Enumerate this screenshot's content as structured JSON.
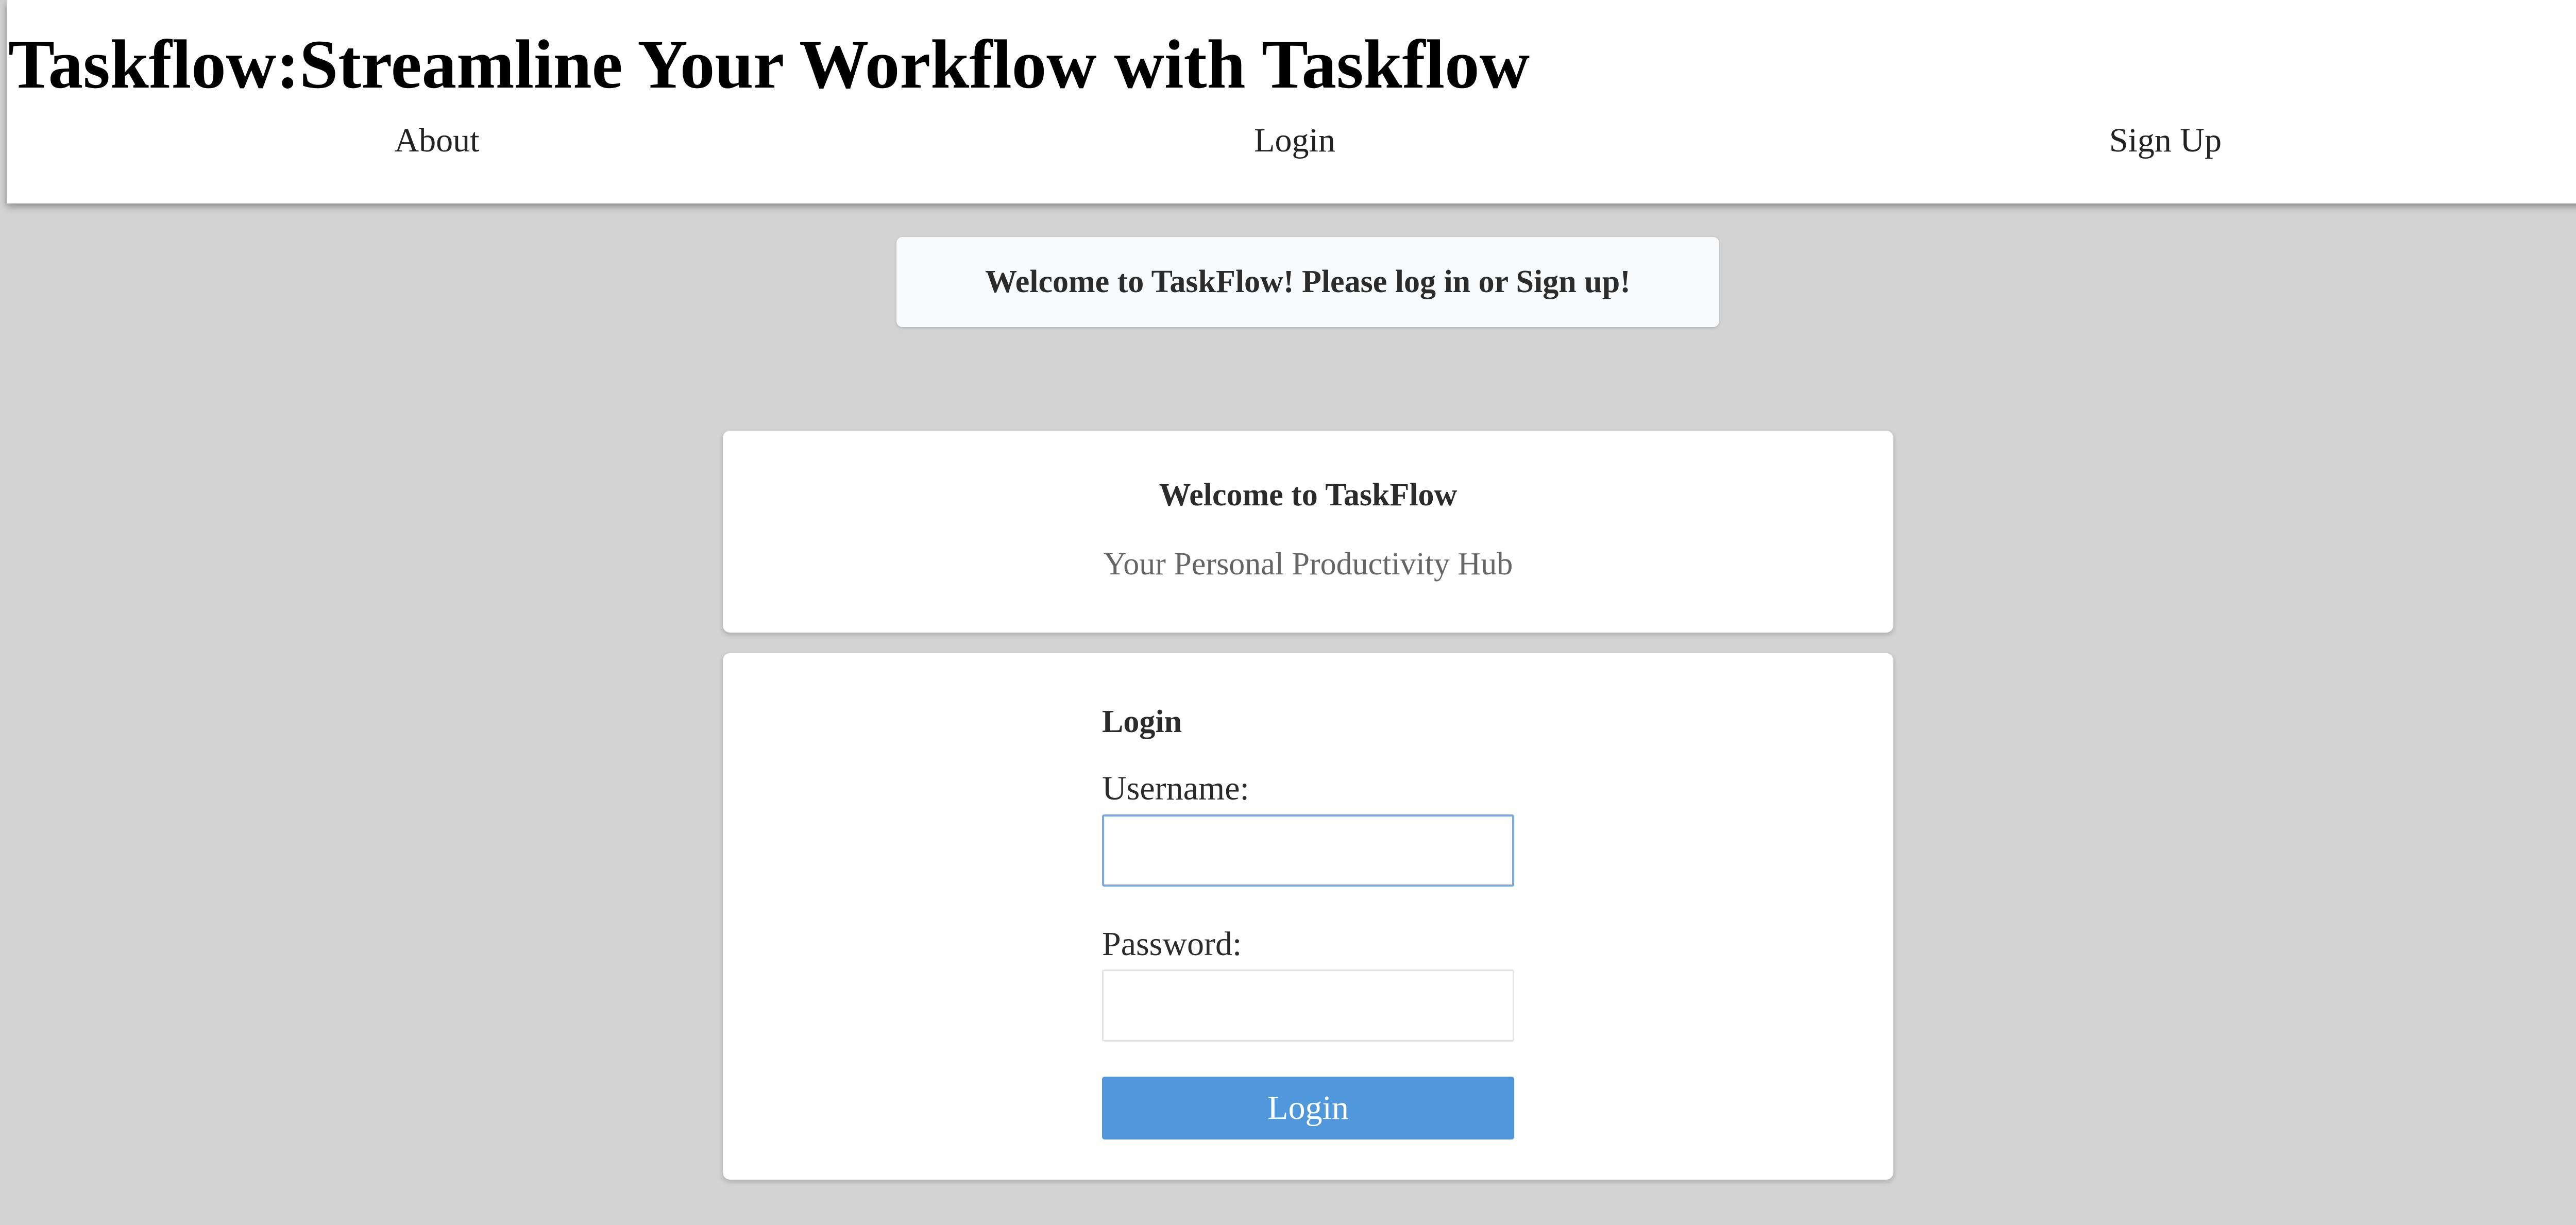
{
  "header": {
    "title": "Taskflow:Streamline Your Workflow with Taskflow",
    "nav": [
      {
        "label": "About"
      },
      {
        "label": "Login"
      },
      {
        "label": "Sign Up"
      }
    ]
  },
  "banner": {
    "message": "Welcome to TaskFlow! Please log in or Sign up!"
  },
  "welcome_card": {
    "title": "Welcome to TaskFlow",
    "subtitle": "Your Personal Productivity Hub"
  },
  "login_form": {
    "heading": "Login",
    "username_label": "Username:",
    "username_value": "",
    "password_label": "Password:",
    "password_value": "",
    "submit_label": "Login"
  },
  "colors": {
    "page_background": "#d3d3d3",
    "header_background": "#ffffff",
    "primary_button": "#5197dc",
    "focus_border": "#7aa7e8"
  }
}
